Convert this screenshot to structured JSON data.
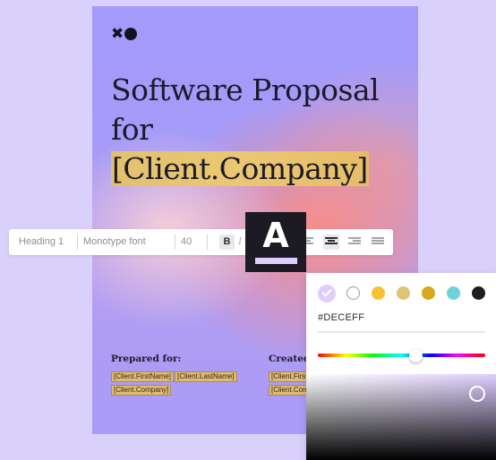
{
  "document": {
    "title_line1": "Software Proposal",
    "title_line2_prefix": "for ",
    "title_highlight": "[Client.Company]",
    "prepared_for_label": "Prepared for:",
    "created_by_label": "Created b",
    "prepared_tags": [
      "[Client.FirstName]",
      "[Client.LastName]",
      "[Client.Company]"
    ],
    "created_tags": [
      "[Client.First",
      "[Client.Comp"
    ]
  },
  "toolbar": {
    "style": "Heading 1",
    "font": "Monotype font",
    "size": "40",
    "bold": "B",
    "italic": "I",
    "alignments": [
      "align-left-icon",
      "align-center-icon",
      "align-right-icon",
      "justify-icon"
    ],
    "active_alignment": "align-center-icon"
  },
  "font_color_button": {
    "letter": "A",
    "color": "#DECEFF"
  },
  "color_picker": {
    "swatches": [
      "#DECEFF",
      "#FFFFFF",
      "#F7C136",
      "#DEC57A",
      "#D4A91C",
      "#6CD3D8",
      "#1E1E22"
    ],
    "selected_swatch": "#DECEFF",
    "hex_value": "#DECEFF"
  }
}
